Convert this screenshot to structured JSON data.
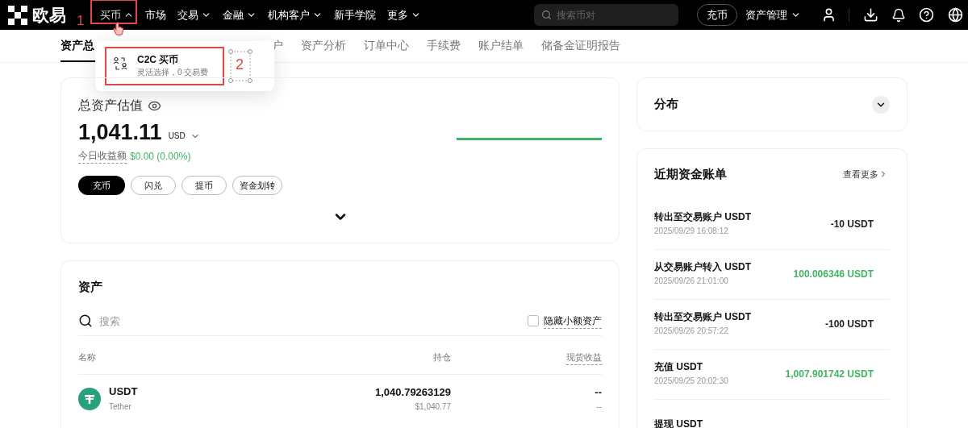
{
  "nav": {
    "logo": "欧易",
    "menu": [
      {
        "label": "买币",
        "kind": "menu",
        "expanded": true,
        "marked": true
      },
      {
        "label": "市场",
        "kind": "link",
        "expanded": false,
        "marked": false
      },
      {
        "label": "交易",
        "kind": "menu",
        "expanded": false,
        "marked": false
      },
      {
        "label": "金融",
        "kind": "menu",
        "expanded": false,
        "marked": false
      },
      {
        "label": "机构客户",
        "kind": "menu",
        "expanded": false,
        "marked": false
      },
      {
        "label": "新手学院",
        "kind": "link",
        "expanded": false,
        "marked": false
      },
      {
        "label": "更多",
        "kind": "menu",
        "expanded": false,
        "marked": false
      }
    ],
    "search": {
      "placeholder": "搜索币对"
    },
    "deposit_button": "充币",
    "asset_menu": "资产管理"
  },
  "annotations": [
    "1",
    "2"
  ],
  "dropdown": {
    "items": [
      {
        "title": "C2C 买币",
        "subtitle": "灵活选择，0 交易费",
        "marked": true
      }
    ]
  },
  "tabs": [
    {
      "label": "资产总",
      "selected": true
    },
    {
      "label": "户",
      "selected": false
    },
    {
      "label": "资产分析",
      "selected": false
    },
    {
      "label": "订单中心",
      "selected": false
    },
    {
      "label": "手续费",
      "selected": false
    },
    {
      "label": "账户结单",
      "selected": false
    },
    {
      "label": "储备金证明报告",
      "selected": false
    }
  ],
  "overview": {
    "title": "总资产估值",
    "amount": "1,041.11",
    "currency": "USD",
    "pnl_label": "今日收益额",
    "pnl_value": "$0.00 (0.00%)",
    "actions": [
      {
        "label": "充币",
        "primary": true
      },
      {
        "label": "闪兑",
        "primary": false
      },
      {
        "label": "提币",
        "primary": false
      },
      {
        "label": "资金划转",
        "primary": false
      }
    ]
  },
  "assets": {
    "title": "资产",
    "search": {
      "placeholder": "搜索"
    },
    "hide_small": {
      "label": "隐藏小额资产",
      "checked": false
    },
    "columns": [
      "名称",
      "持仓",
      "现货收益"
    ],
    "rows": [
      {
        "symbol": "USDT",
        "name": "Tether",
        "amount": "1,040.79263129",
        "value": "$1,040.77",
        "pnl": "--",
        "pnl_sub": "--"
      }
    ]
  },
  "distribution": {
    "title": "分布"
  },
  "bills": {
    "title": "近期资金账单",
    "more": "查看更多",
    "items": [
      {
        "title": "转出至交易账户 USDT",
        "time": "2025/09/29 16:08:12",
        "amount": "-10 USDT",
        "positive": false
      },
      {
        "title": "从交易账户转入 USDT",
        "time": "2025/09/26 21:01:00",
        "amount": "100.006346 USDT",
        "positive": true
      },
      {
        "title": "转出至交易账户 USDT",
        "time": "2025/09/26 20:57:22",
        "amount": "-100 USDT",
        "positive": false
      },
      {
        "title": "充值 USDT",
        "time": "2025/09/25 20:02:30",
        "amount": "1,007.901742 USDT",
        "positive": true
      },
      {
        "title": "提现 USDT"
      }
    ]
  }
}
